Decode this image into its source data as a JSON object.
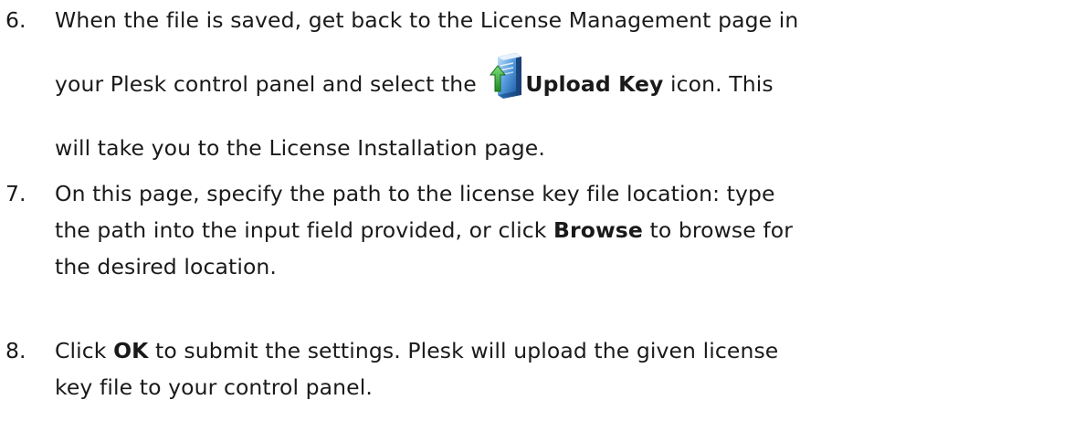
{
  "steps": [
    {
      "number": "6.",
      "line1": "When the file is saved, get back to the License Management page in",
      "line2_before": "your Plesk control panel and select the",
      "icon": "upload-key-icon",
      "line2_bold": "Upload Key",
      "line2_after": " icon. This",
      "line3": "will take you to the License Installation page."
    },
    {
      "number": "7.",
      "line1": "On this page, specify the path to the license key file location: type",
      "line2_before": "the path into the input field provided, or click ",
      "line2_bold": "Browse",
      "line2_after": " to browse for",
      "line3": "the desired location."
    },
    {
      "number": "8.",
      "line1_before": "Click ",
      "line1_bold": "OK",
      "line1_after": " to submit the settings. Plesk will upload the given license",
      "line2": "key file to your control panel."
    }
  ],
  "colors": {
    "text": "#1a1a1a",
    "icon_green": "#2e9a2e",
    "icon_blue": "#3a7fc8"
  }
}
